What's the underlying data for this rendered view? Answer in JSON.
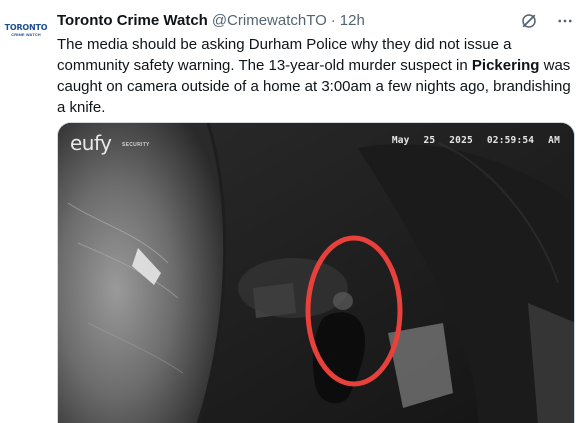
{
  "account": {
    "avatar_text": "TORONTO",
    "avatar_subtext": "CRIME WATCH",
    "display_name": "Toronto Crime Watch",
    "handle": "@CrimewatchTO",
    "separator": "·",
    "timestamp": "12h"
  },
  "icons": {
    "grok": "grok-icon",
    "more": "more-icon"
  },
  "tweet": {
    "text_part1": "The media should be asking Durham Police why they did not issue a community safety warning.  The 13-year-old murder suspect in ",
    "text_bold": "Pickering",
    "text_part2": " was caught on camera outside of a home at 3:00am a few nights ago, brandishing a knife."
  },
  "media": {
    "camera_brand": "eufy",
    "camera_brand_sub": "SECURITY",
    "date_stamp": "May 25 2025",
    "time_stamp": "02:59:54 AM",
    "highlight_color": "#e8403a"
  }
}
